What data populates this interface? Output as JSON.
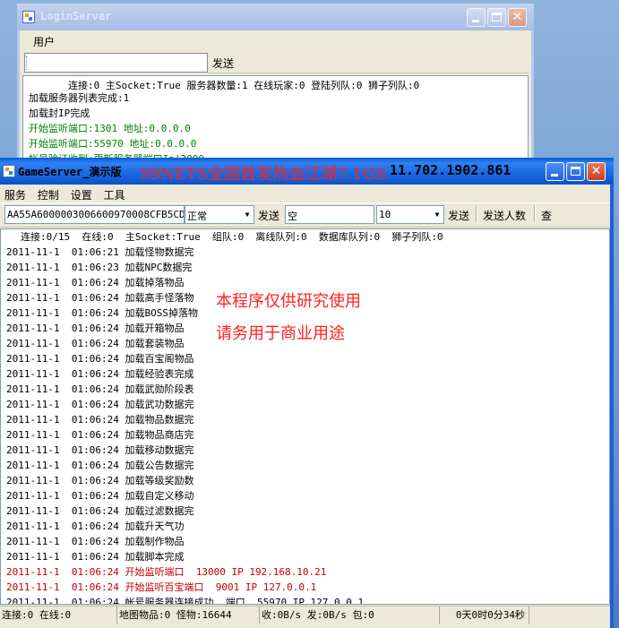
{
  "login_window": {
    "title": "LoginServer",
    "menu": [
      "用户"
    ],
    "send_label": "发送",
    "log_header": "连接:0 主Socket:True 服务器数量:1 在线玩家:0 登陆列队:0 狮子列队:0",
    "log": [
      {
        "text": "加载服务器列表完成:1",
        "color": "black"
      },
      {
        "text": "加载封IP完成",
        "color": "black"
      },
      {
        "text": "开始监听端口:1301 地址:0.0.0.0",
        "color": "green"
      },
      {
        "text": "开始监听端口:55970 地址:0.0.0.0",
        "color": "green"
      },
      {
        "text": "帐号验证收到:更新服务器端口Ip|2000",
        "color": "green"
      }
    ]
  },
  "game_window": {
    "title": "GameServer_演示版",
    "menu": [
      "服务",
      "控制",
      "设置",
      "工具"
    ],
    "toolbar": {
      "hex_value": "AA55A6000003006600970008CFB5CDB3(",
      "mode_value": "正常",
      "send1_label": "发送",
      "empty_value": "空",
      "count_value": "10",
      "send2_label": "发送",
      "send_count_label": "发送人数",
      "query_label": "查"
    },
    "log_header": "连接:0/15  在线:0  主Socket:True  组队:0  离线队列:0  数据库队列:0  狮子列队:0",
    "log": [
      {
        "time": "2011-11-1  01:06:21",
        "msg": "加载怪物数据完",
        "color": "black"
      },
      {
        "time": "2011-11-1  01:06:23",
        "msg": "加载NPC数据完",
        "color": "black"
      },
      {
        "time": "2011-11-1  01:06:24",
        "msg": "加载掉落物品",
        "color": "black"
      },
      {
        "time": "2011-11-1  01:06:24",
        "msg": "加载高手怪落物",
        "color": "black"
      },
      {
        "time": "2011-11-1  01:06:24",
        "msg": "加载BOSS掉落物",
        "color": "black"
      },
      {
        "time": "2011-11-1  01:06:24",
        "msg": "加载开箱物品",
        "color": "black"
      },
      {
        "time": "2011-11-1  01:06:24",
        "msg": "加载套装物品",
        "color": "black"
      },
      {
        "time": "2011-11-1  01:06:24",
        "msg": "加载百宝阁物品",
        "color": "black"
      },
      {
        "time": "2011-11-1  01:06:24",
        "msg": "加载经验表完成",
        "color": "black"
      },
      {
        "time": "2011-11-1  01:06:24",
        "msg": "加载武勋阶段表",
        "color": "black"
      },
      {
        "time": "2011-11-1  01:06:24",
        "msg": "加载武功数据完",
        "color": "black"
      },
      {
        "time": "2011-11-1  01:06:24",
        "msg": "加载物品数据完",
        "color": "black"
      },
      {
        "time": "2011-11-1  01:06:24",
        "msg": "加载物品商店完",
        "color": "black"
      },
      {
        "time": "2011-11-1  01:06:24",
        "msg": "加载移动数据完",
        "color": "black"
      },
      {
        "time": "2011-11-1  01:06:24",
        "msg": "加载公告数据完",
        "color": "black"
      },
      {
        "time": "2011-11-1  01:06:24",
        "msg": "加载等级奖励数",
        "color": "black"
      },
      {
        "time": "2011-11-1  01:06:24",
        "msg": "加载自定义移动",
        "color": "black"
      },
      {
        "time": "2011-11-1  01:06:24",
        "msg": "加载过滤数据完",
        "color": "black"
      },
      {
        "time": "2011-11-1  01:06:24",
        "msg": "加载升天气功",
        "color": "black"
      },
      {
        "time": "2011-11-1  01:06:24",
        "msg": "加载制作物品",
        "color": "black"
      },
      {
        "time": "2011-11-1  01:06:24",
        "msg": "加载脚本完成",
        "color": "black"
      },
      {
        "time": "2011-11-1  01:06:24",
        "msg": "开始监听端口  13000 IP 192.168.10.21",
        "color": "red"
      },
      {
        "time": "2011-11-1  01:06:24",
        "msg": "开始监听百宝端口  9001 IP 127.0.0.1",
        "color": "red"
      },
      {
        "time": "2011-11-1  01:06:24",
        "msg": "帐号服务器连接成功  端口  55970 IP 127.0.0.1",
        "color": "black"
      }
    ],
    "status": {
      "conn": "连接:0 在线:0",
      "map": "地图物品:0 怪物:16644",
      "traffic": "收:0B/s 发:0B/s 包:0",
      "uptime": "0天0时0分34秒"
    }
  },
  "overlay": {
    "banner": "99NETS全国首发热血江湖7.1GS",
    "banner_number": "11.702.1902.861",
    "notice_line1": "本程序仅供研究使用",
    "notice_line2": "请务用于商业用途"
  },
  "colors": {
    "green": "#008000",
    "red": "#c00000",
    "overlay_red": "#ff2020",
    "titlebar_blue": "#1d6be4"
  }
}
